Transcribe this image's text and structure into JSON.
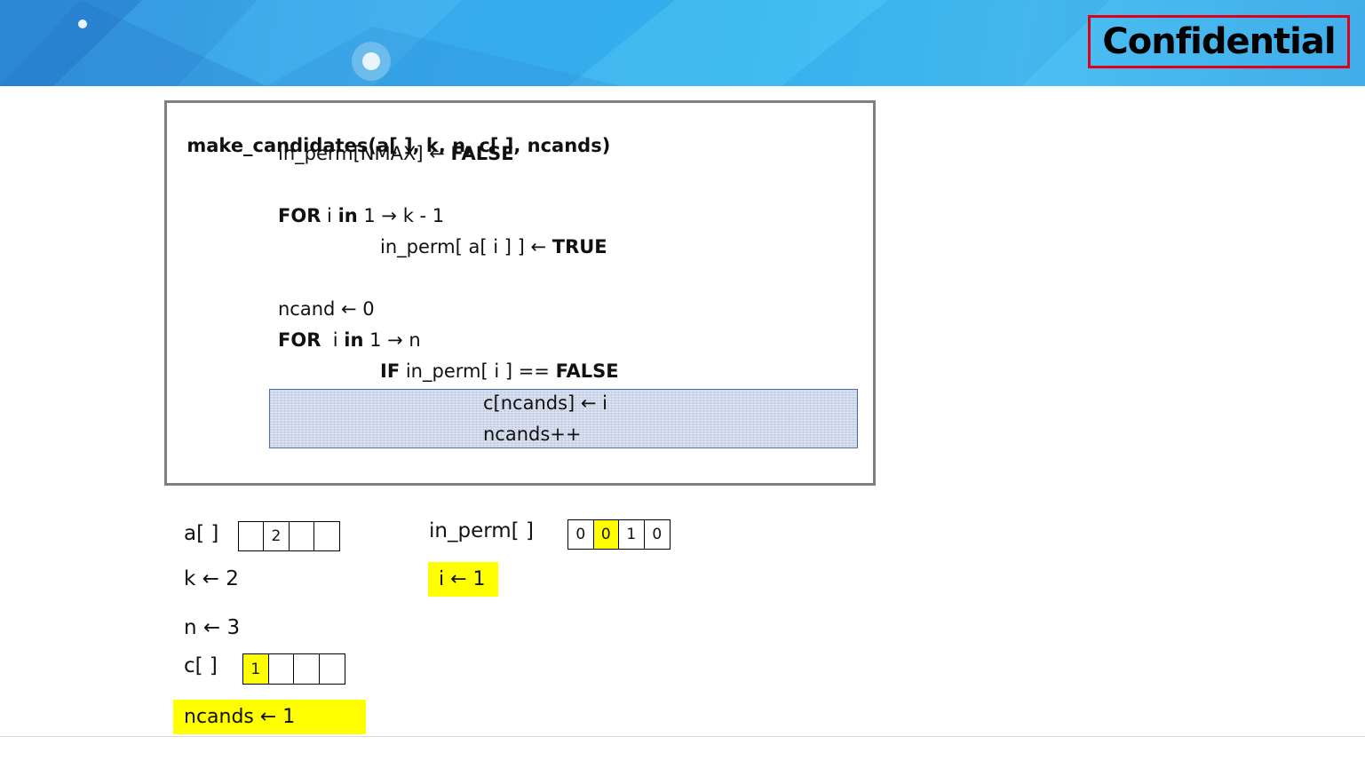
{
  "header": {
    "badge": "Confidential"
  },
  "code": {
    "signature": "make_candidates(a[ ], k, n, c[ ], ncands)",
    "l1_pre": "in_perm[NMAX] ← ",
    "l1_kw": "FALSE",
    "l2_kw1": "FOR",
    "l2_mid": " i ",
    "l2_kw2": "in",
    "l2_post": " 1 → k - 1",
    "l3_pre": "in_perm[ a[ i ] ] ← ",
    "l3_kw": "TRUE",
    "l4": "ncand ← 0",
    "l5_kw1": "FOR",
    "l5_mid": "  i ",
    "l5_kw2": "in",
    "l5_post": " 1 → n",
    "l6_kw": "IF",
    "l6_mid": " in_perm[ i ] == ",
    "l6_kw2": "FALSE",
    "l7": "c[ncands] ← i",
    "l8": "ncands++"
  },
  "vars": {
    "a_label": "a[ ]",
    "a_cells": [
      "",
      "2",
      "",
      ""
    ],
    "k_text": "k ← 2",
    "n_text": "n ← 3",
    "c_label": "c[ ]",
    "c_cells": [
      "1",
      "",
      "",
      ""
    ],
    "ncands_text": "ncands ← 1",
    "inperm_label": "in_perm[ ]",
    "inperm_cells": [
      "0",
      "0",
      "1",
      "0"
    ],
    "i_text": "i ← 1"
  },
  "colors": {
    "highlight": "#ffff00",
    "badge_border": "#e0001a",
    "code_border": "#7f7f7f",
    "banner": "#33b7f0"
  }
}
